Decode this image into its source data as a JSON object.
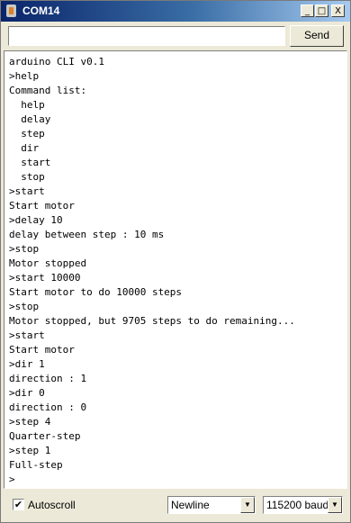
{
  "window": {
    "title": "COM14"
  },
  "window_controls": {
    "minimize": "_",
    "maximize": "□",
    "close": "X"
  },
  "input": {
    "value": "",
    "placeholder": ""
  },
  "send_label": "Send",
  "console_lines": [
    "arduino CLI v0.1",
    ">help",
    "Command list:",
    "  help",
    "  delay",
    "  step",
    "  dir",
    "  start",
    "  stop",
    ">start",
    "Start motor",
    ">delay 10",
    "delay between step : 10 ms",
    ">stop",
    "Motor stopped",
    ">start 10000",
    "Start motor to do 10000 steps",
    ">stop",
    "Motor stopped, but 9705 steps to do remaining...",
    ">start",
    "Start motor",
    ">dir 1",
    "direction : 1",
    ">dir 0",
    "direction : 0",
    ">step 4",
    "Quarter-step",
    ">step 1",
    "Full-step",
    ">"
  ],
  "footer": {
    "autoscroll_label": "Autoscroll",
    "autoscroll_checked": true,
    "checkmark": "✔",
    "line_ending": "Newline",
    "baud_rate": "115200 baud",
    "dropdown_arrow": "▼"
  }
}
